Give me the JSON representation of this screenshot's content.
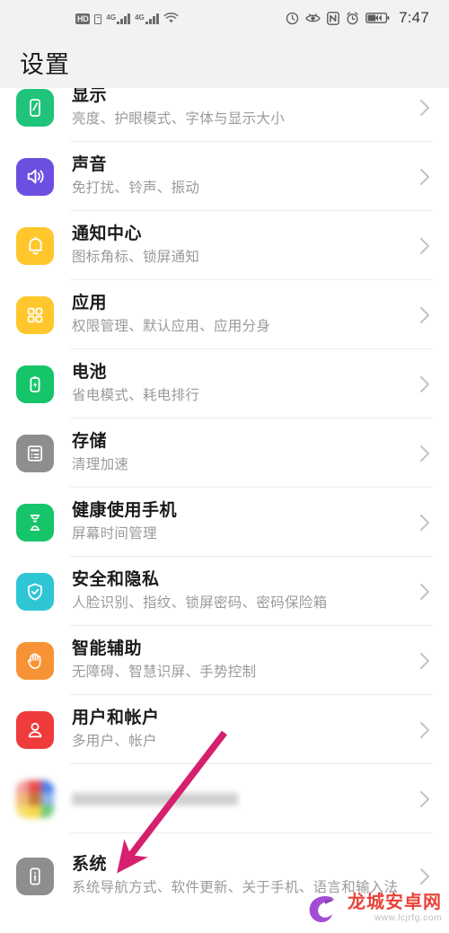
{
  "statusbar": {
    "hd_badge": "HD",
    "network_label_1": "4G",
    "network_label_2": "4G",
    "time": "7:47",
    "icons": [
      "hd-badge-icon",
      "sim-card-icon",
      "signal-4g-icon-1",
      "signal-4g-icon-2",
      "wifi-icon",
      "timer-refresh-icon",
      "eye-comfort-icon",
      "nfc-icon",
      "alarm-clock-icon",
      "battery-charging-icon"
    ]
  },
  "header": {
    "title": "设置"
  },
  "colors": {
    "display_icon": "#1fc47a",
    "sound_icon": "#6c4fe0",
    "notification_icon": "#ffc72c",
    "apps_icon": "#ffc72c",
    "battery_icon": "#16c46a",
    "storage_icon": "#8e8e8e",
    "digital_balance_icon": "#16c46a",
    "security_icon": "#2ec6d4",
    "accessibility_icon": "#f79334",
    "users_icon": "#ef3b3b",
    "system_icon": "#8e8e8e",
    "annotation_arrow": "#d61f6e",
    "watermark_title": "#e8332a",
    "watermark_logo": "#9b3fd1"
  },
  "list": {
    "items": [
      {
        "id": "display",
        "title": "显示",
        "subtitle": "亮度、护眼模式、字体与显示大小",
        "icon": "phone-brightness-icon",
        "chevron": "chevron-right-icon"
      },
      {
        "id": "sound",
        "title": "声音",
        "subtitle": "免打扰、铃声、振动",
        "icon": "speaker-icon",
        "chevron": "chevron-right-icon"
      },
      {
        "id": "notifications",
        "title": "通知中心",
        "subtitle": "图标角标、锁屏通知",
        "icon": "bell-icon",
        "chevron": "chevron-right-icon"
      },
      {
        "id": "apps",
        "title": "应用",
        "subtitle": "权限管理、默认应用、应用分身",
        "icon": "grid-apps-icon",
        "chevron": "chevron-right-icon"
      },
      {
        "id": "battery",
        "title": "电池",
        "subtitle": "省电模式、耗电排行",
        "icon": "battery-icon",
        "chevron": "chevron-right-icon"
      },
      {
        "id": "storage",
        "title": "存储",
        "subtitle": "清理加速",
        "icon": "storage-list-icon",
        "chevron": "chevron-right-icon"
      },
      {
        "id": "digital-balance",
        "title": "健康使用手机",
        "subtitle": "屏幕时间管理",
        "icon": "hourglass-icon",
        "chevron": "chevron-right-icon"
      },
      {
        "id": "security-privacy",
        "title": "安全和隐私",
        "subtitle": "人脸识别、指纹、锁屏密码、密码保险箱",
        "icon": "shield-check-icon",
        "chevron": "chevron-right-icon"
      },
      {
        "id": "smart-assistance",
        "title": "智能辅助",
        "subtitle": "无障碍、智慧识屏、手势控制",
        "icon": "hand-icon",
        "chevron": "chevron-right-icon"
      },
      {
        "id": "users-accounts",
        "title": "用户和帐户",
        "subtitle": "多用户、帐户",
        "icon": "user-icon",
        "chevron": "chevron-right-icon"
      },
      {
        "id": "blurred-item",
        "title": "",
        "subtitle": "",
        "icon": "color-grid-icon",
        "chevron": "chevron-right-icon"
      },
      {
        "id": "system",
        "title": "系统",
        "subtitle": "系统导航方式、软件更新、关于手机、语言和输入法",
        "icon": "system-info-icon",
        "chevron": "chevron-right-icon"
      }
    ]
  },
  "annotation": {
    "type": "arrow",
    "target": "system",
    "color": "#d61f6e"
  },
  "watermark": {
    "title": "龙城安卓网",
    "url": "www.lcjrfg.com"
  }
}
